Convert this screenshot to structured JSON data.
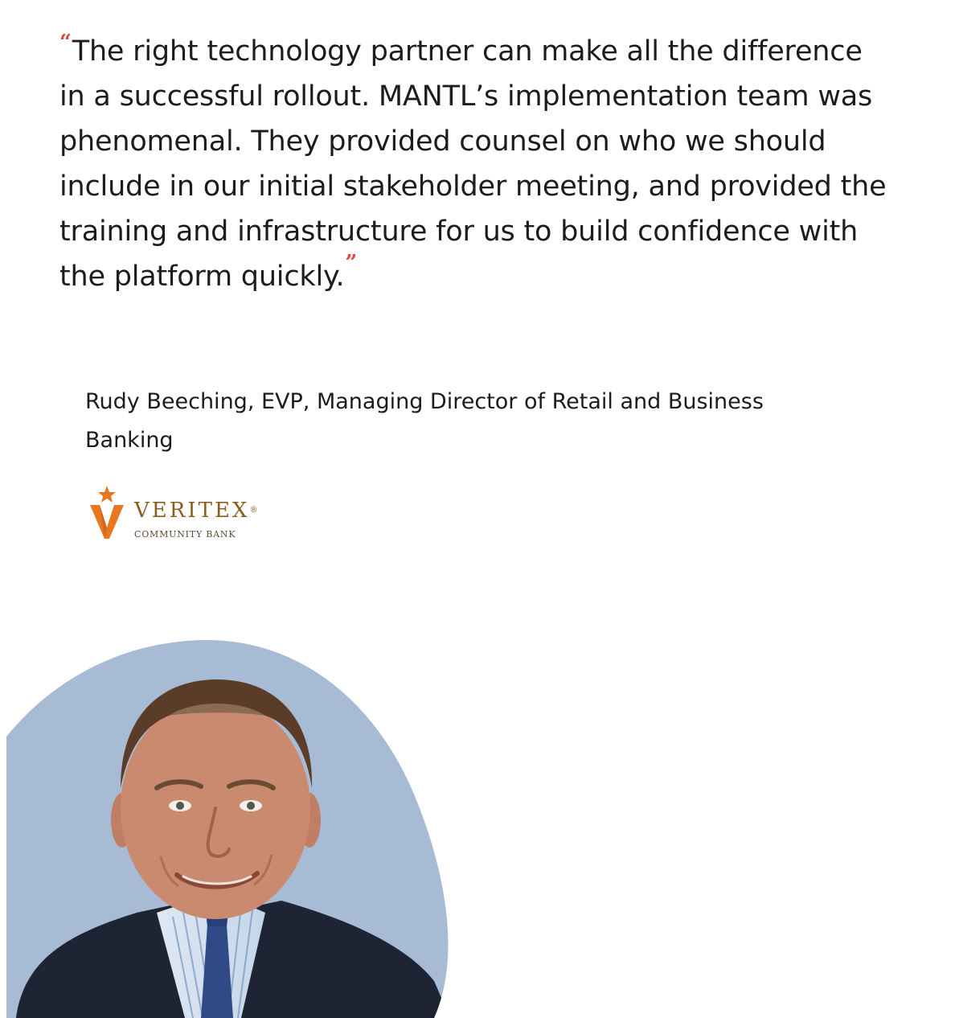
{
  "testimonial": {
    "quote": "The right technology partner can make all the difference in a successful rollout. MANTL’s implementation team was phenomenal. They provided counsel on who we should include in our initial stakeholder meeting, and provided the training and infrastructure for us to build confidence with the platform quickly.",
    "open_quote_mark": "“",
    "close_quote_mark": "”",
    "attribution": "Rudy Beeching, EVP, Managing Director of Retail and Business Banking"
  },
  "logo": {
    "name": "VERITEX",
    "registered_mark": "®",
    "subtitle": "COMMUNITY BANK",
    "icon": "star-v-icon",
    "colors": {
      "star": "#e87722",
      "v_mark": "#e87722",
      "wordmark": "#8b5e20"
    }
  },
  "portrait": {
    "icon": "person-photo",
    "colors": {
      "blob_background": "#a7bbd4",
      "jacket": "#1e2433",
      "skin": "#c98a70"
    }
  },
  "colors": {
    "quote_marks": "#e0463f",
    "text": "#1f1b1b",
    "background": "#ffffff"
  }
}
